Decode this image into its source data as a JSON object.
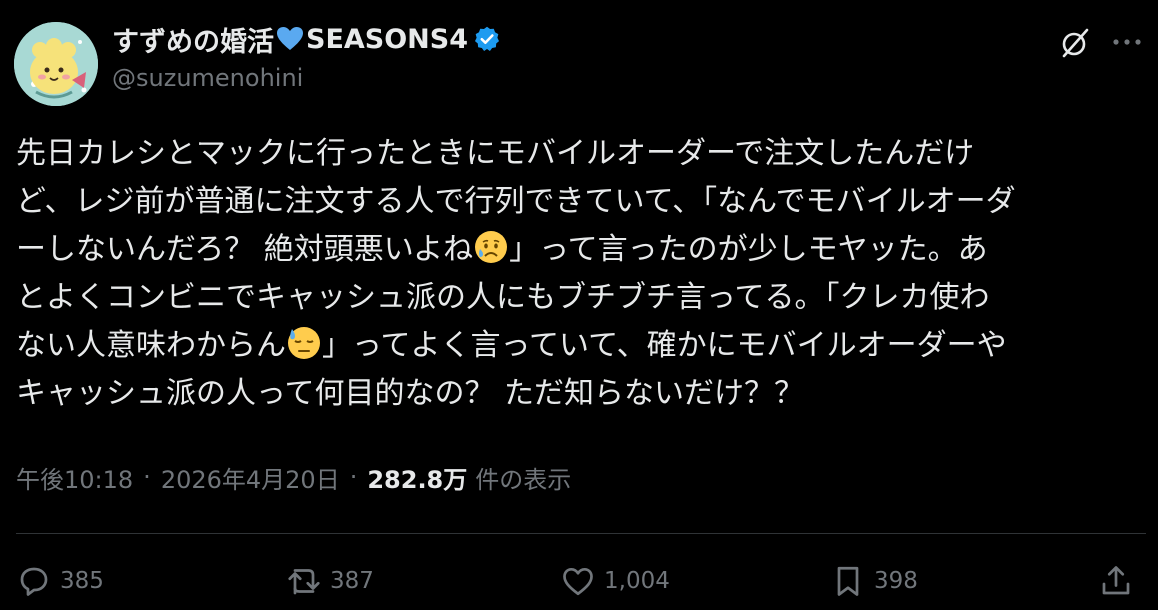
{
  "author": {
    "display_name": "すずめの婚活",
    "name_suffix": "SEASONS4",
    "handle": "@suzumenohini",
    "verified": true
  },
  "tweet": {
    "lines": [
      "先日カレシとマックに行ったときにモバイルオーダーで注文したんだけ",
      "ど、レジ前が普通に注文する人で行列できていて、「なんでモバイルオーダ",
      [
        "ーしないんだろ？ 絶対頭悪いよね",
        "」って言ったのが少しモヤッた。あ"
      ],
      "とよくコンビニでキャッシュ派の人にもブチブチ言ってる。「クレカ使わ",
      [
        "ない人意味わからん",
        "」ってよく言っていて、確かにモバイルオーダーや"
      ],
      "キャッシュ派の人って何目的なの？ ただ知らないだけ？？"
    ],
    "emojis": [
      "sad-but-relieved-face-emoji",
      "downcast-face-with-sweat-emoji"
    ]
  },
  "meta": {
    "time": "午後10:18",
    "separator": "·",
    "date": "2026年4月20日",
    "views_count": "282.8万",
    "views_label": "件の表示"
  },
  "actions": {
    "reply_count": "385",
    "retweet_count": "387",
    "like_count": "1,004",
    "bookmark_count": "398"
  },
  "icons": [
    "grok-icon",
    "more-icon",
    "verified-badge-icon",
    "reply-icon",
    "retweet-icon",
    "like-icon",
    "bookmark-icon",
    "share-icon"
  ],
  "colors": {
    "background": "#000000",
    "text": "#e7e9ea",
    "secondary": "#71767b",
    "verified": "#1d9bf0",
    "heart": "#5aa9f0"
  }
}
